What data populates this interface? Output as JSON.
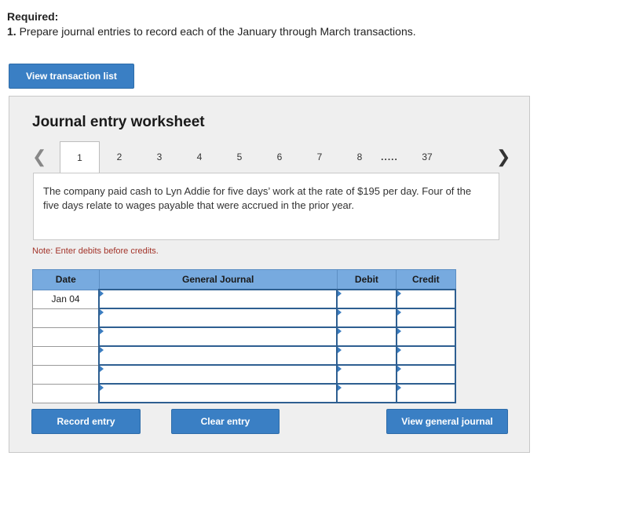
{
  "required": {
    "heading": "Required:",
    "number": "1.",
    "text": "Prepare journal entries to record each of the January through March transactions."
  },
  "view_transaction_list": "View transaction list",
  "worksheet": {
    "title": "Journal entry worksheet",
    "tabs": [
      "1",
      "2",
      "3",
      "4",
      "5",
      "6",
      "7",
      "8",
      ".....",
      "37"
    ],
    "active_tab": "1",
    "description": "The company paid cash to Lyn Addie for five days’ work at the rate of $195 per day. Four of the five days relate to wages payable that were accrued in the prior year.",
    "note": "Note: Enter debits before credits.",
    "table": {
      "headers": {
        "date": "Date",
        "journal": "General Journal",
        "debit": "Debit",
        "credit": "Credit"
      },
      "rows": [
        {
          "date": "Jan 04",
          "account": "",
          "debit": "",
          "credit": ""
        },
        {
          "date": "",
          "account": "",
          "debit": "",
          "credit": ""
        },
        {
          "date": "",
          "account": "",
          "debit": "",
          "credit": ""
        },
        {
          "date": "",
          "account": "",
          "debit": "",
          "credit": ""
        },
        {
          "date": "",
          "account": "",
          "debit": "",
          "credit": ""
        },
        {
          "date": "",
          "account": "",
          "debit": "",
          "credit": ""
        }
      ]
    },
    "buttons": {
      "record": "Record entry",
      "clear": "Clear entry",
      "view_journal": "View general journal"
    }
  },
  "colors": {
    "button": "#3a7fc4",
    "table_header": "#77aadf",
    "note": "#a3342a"
  },
  "icons": {
    "prev": "chevron-left-icon",
    "next": "chevron-right-icon"
  }
}
